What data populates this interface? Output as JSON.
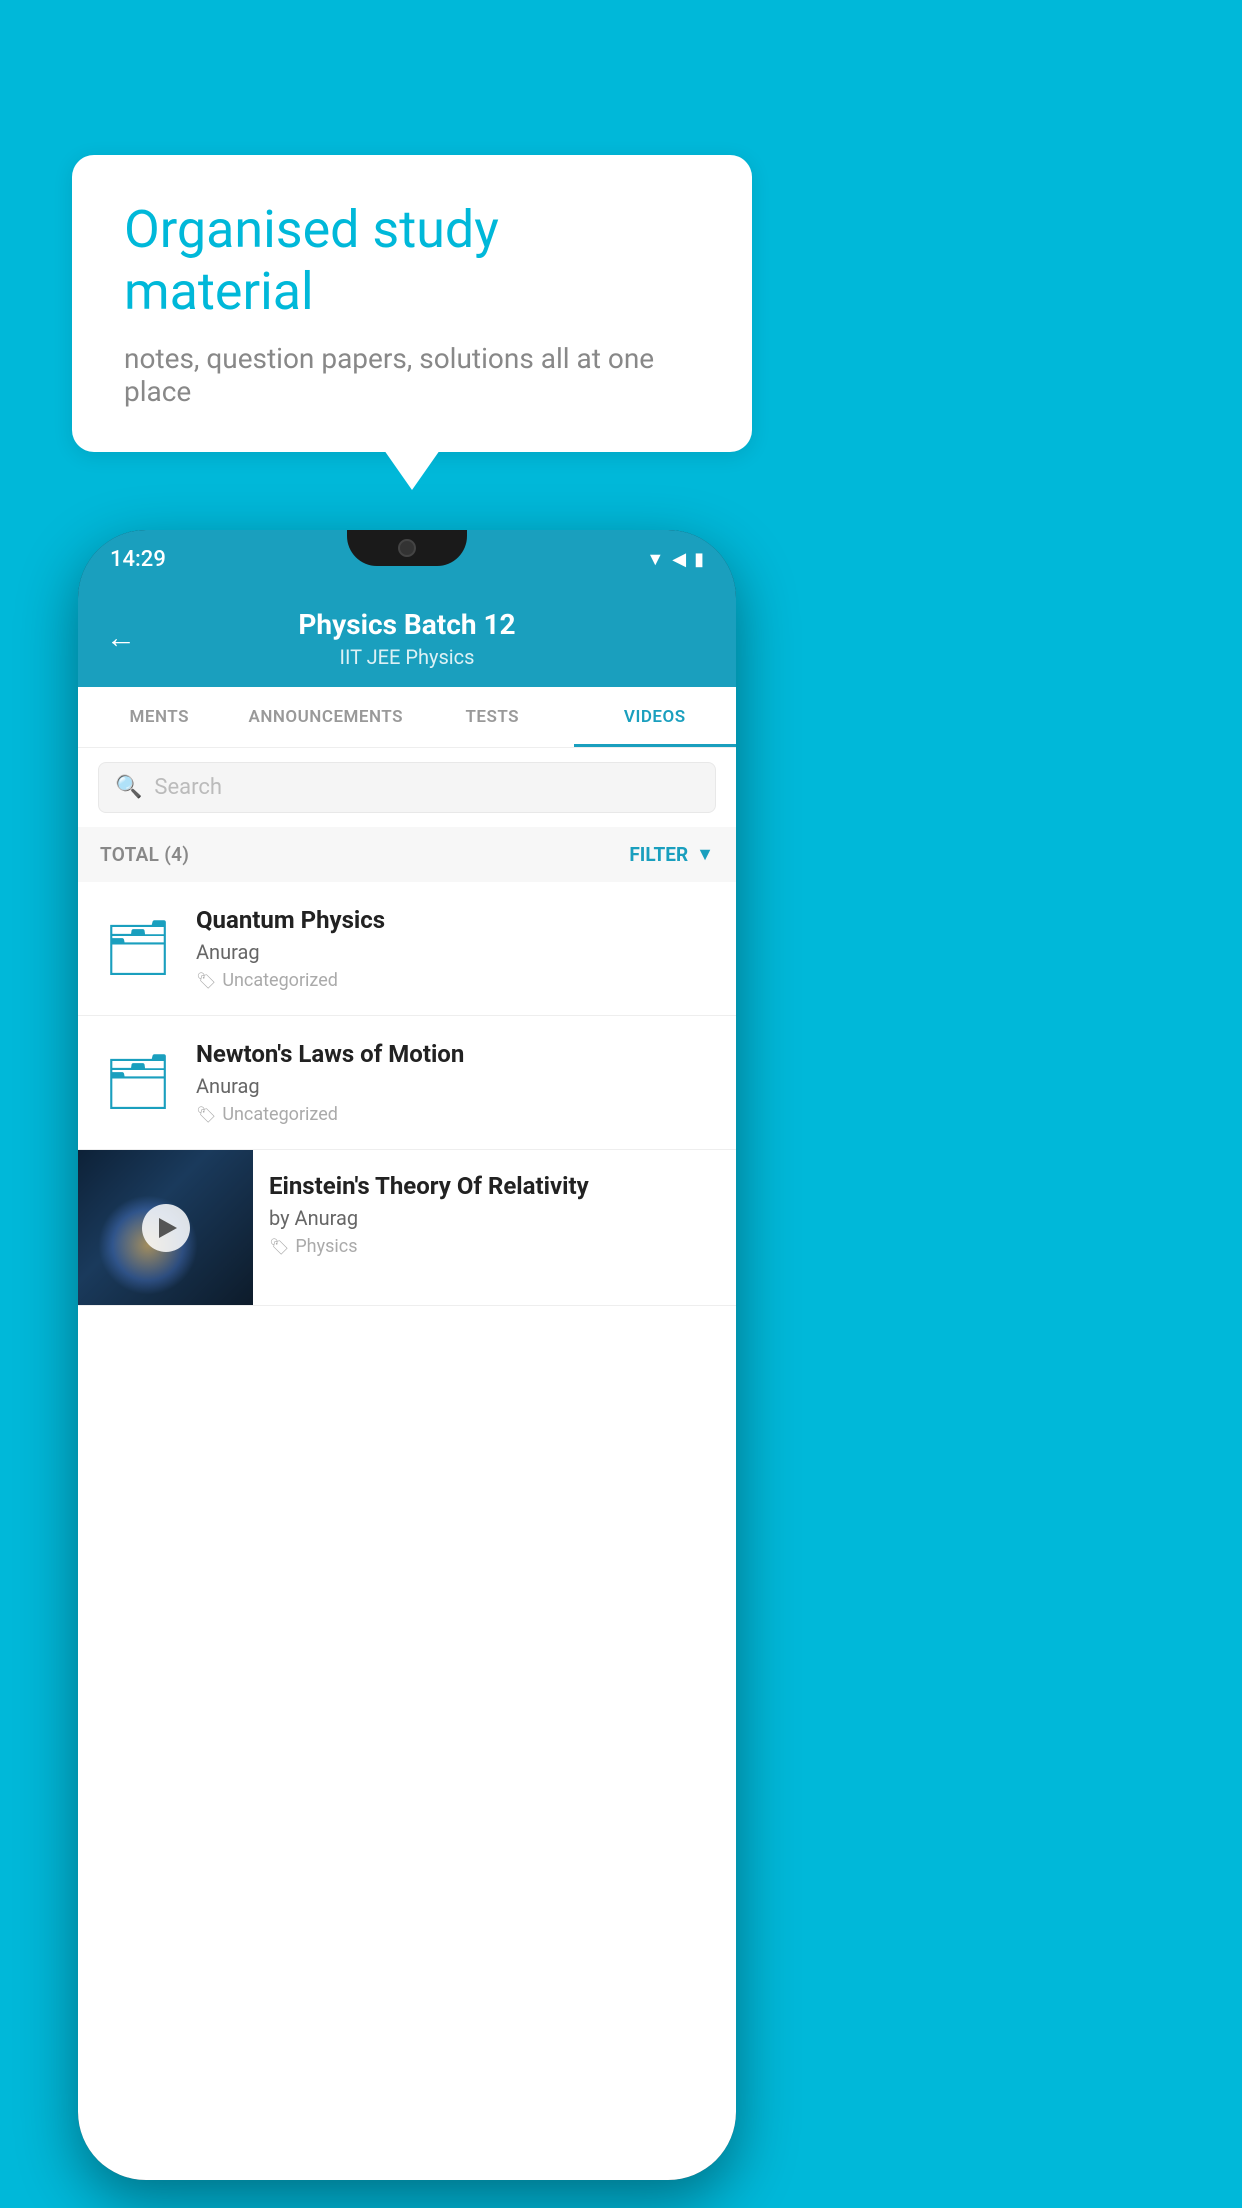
{
  "background": {
    "color": "#00b8d9"
  },
  "speech_bubble": {
    "title": "Organised study material",
    "subtitle": "notes, question papers, solutions all at one place"
  },
  "phone": {
    "time": "14:29",
    "header": {
      "back_label": "←",
      "title": "Physics Batch 12",
      "subtitle": "IIT JEE   Physics"
    },
    "tabs": [
      {
        "label": "MENTS",
        "active": false
      },
      {
        "label": "ANNOUNCEMENTS",
        "active": false
      },
      {
        "label": "TESTS",
        "active": false
      },
      {
        "label": "VIDEOS",
        "active": true
      }
    ],
    "search": {
      "placeholder": "Search"
    },
    "filter_bar": {
      "total_label": "TOTAL (4)",
      "filter_label": "FILTER"
    },
    "videos": [
      {
        "title": "Quantum Physics",
        "author": "Anurag",
        "tag": "Uncategorized",
        "type": "folder"
      },
      {
        "title": "Newton's Laws of Motion",
        "author": "Anurag",
        "tag": "Uncategorized",
        "type": "folder"
      },
      {
        "title": "Einstein's Theory Of Relativity",
        "author": "by Anurag",
        "tag": "Physics",
        "type": "video"
      }
    ]
  }
}
